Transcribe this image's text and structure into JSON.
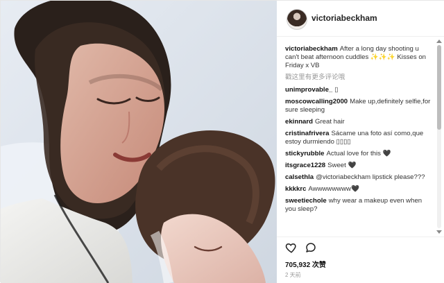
{
  "profile": {
    "username": "victoriabeckham"
  },
  "comments": [
    {
      "author": "victoriabeckham",
      "text": "After a long day shooting u can't beat afternoon cuddles ✨✨✨ Kisses on Friday x VB"
    },
    {
      "author": "unimprovable_",
      "text": "▯"
    },
    {
      "author": "moscowcalling2000",
      "text": "Make up,definitely selfie,for sure sleeping"
    },
    {
      "author": "ekinnard",
      "text": "Great hair"
    },
    {
      "author": "cristinafrivera",
      "text": "Sácame una foto así como,que estoy durmiendo ▯▯▯▯"
    },
    {
      "author": "stickyrubble",
      "text": "Actual love for this 🖤"
    },
    {
      "author": "itsgrace1228",
      "text": "Sweet 🖤"
    },
    {
      "author": "calsethla",
      "text": "@victoriabeckham lipstick please???"
    },
    {
      "author": "kkkkrc",
      "text": "Awwwwwwww🖤"
    },
    {
      "author": "sweetiechole",
      "text": "why wear a makeup even when you sleep?"
    }
  ],
  "more_comments_label": "戳这里有更多评论哦",
  "stats": {
    "likes": "705,932 次赞",
    "time": "2 天前"
  },
  "icons": {
    "like": "heart-outline-icon",
    "comment": "comment-bubble-icon"
  }
}
